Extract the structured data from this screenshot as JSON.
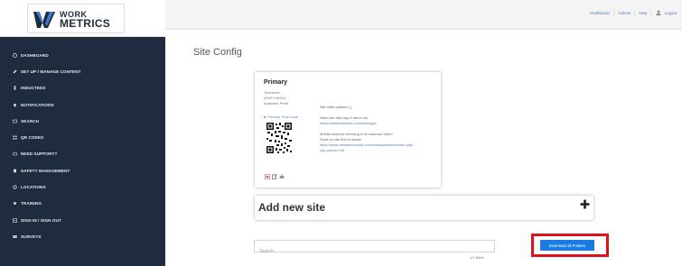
{
  "logo": {
    "line1": "WORK",
    "line2": "METRICS"
  },
  "header": {
    "links": [
      "Dashboard",
      "Actions",
      "Help"
    ],
    "logout": "Logout"
  },
  "sidebar": {
    "items": [
      {
        "label": "DASHBOARD",
        "icon": "dashboard-icon"
      },
      {
        "label": "SET UP / MANAGE CONTENT",
        "icon": "pencil-icon"
      },
      {
        "label": "INDUCTEES",
        "icon": "person-icon"
      },
      {
        "label": "NOTIFICATIONS",
        "icon": "bell-icon"
      },
      {
        "label": "SEARCH",
        "icon": "search-icon"
      },
      {
        "label": "QR CODES",
        "icon": "qr-icon"
      },
      {
        "label": "NEED SUPPORT?",
        "icon": "help-icon"
      },
      {
        "label": "SAFETY MANAGEMENT",
        "icon": "shield-icon"
      },
      {
        "label": "LOCATIONS",
        "icon": "location-icon"
      },
      {
        "label": "TRAINING",
        "icon": "graduation-icon"
      },
      {
        "label": "SIGN IN / SIGN OUT",
        "icon": "sign-in-icon"
      },
      {
        "label": "SURVEYS",
        "icon": "survey-icon"
      }
    ]
  },
  "main": {
    "title": "Site Config",
    "site": {
      "name": "Primary",
      "meta": [
        "Timezone:",
        "(GMT+08:00)",
        "Australia, Perth"
      ],
      "primary_tz": "Primary Time Zone",
      "options_title": "Site wide options [-]",
      "direct_text": "Sites can also log in direct via:",
      "direct_link": "www.onlineinduction.com/worksign/",
      "mobile_text1": "Mobile workers checking in at unknown sites?",
      "mobile_text2": "Scan on site first to share!",
      "mobile_link1": "https://www.onlineinduction.com/worksign/wrkmenthe.php?",
      "mobile_link2": "sig=yalnzb-hn8"
    },
    "add_site": {
      "label": "Add new site"
    },
    "search": {
      "placeholder": "Search",
      "value": ""
    },
    "count": "1/1 Sites",
    "download_button": "Download all Posters"
  }
}
